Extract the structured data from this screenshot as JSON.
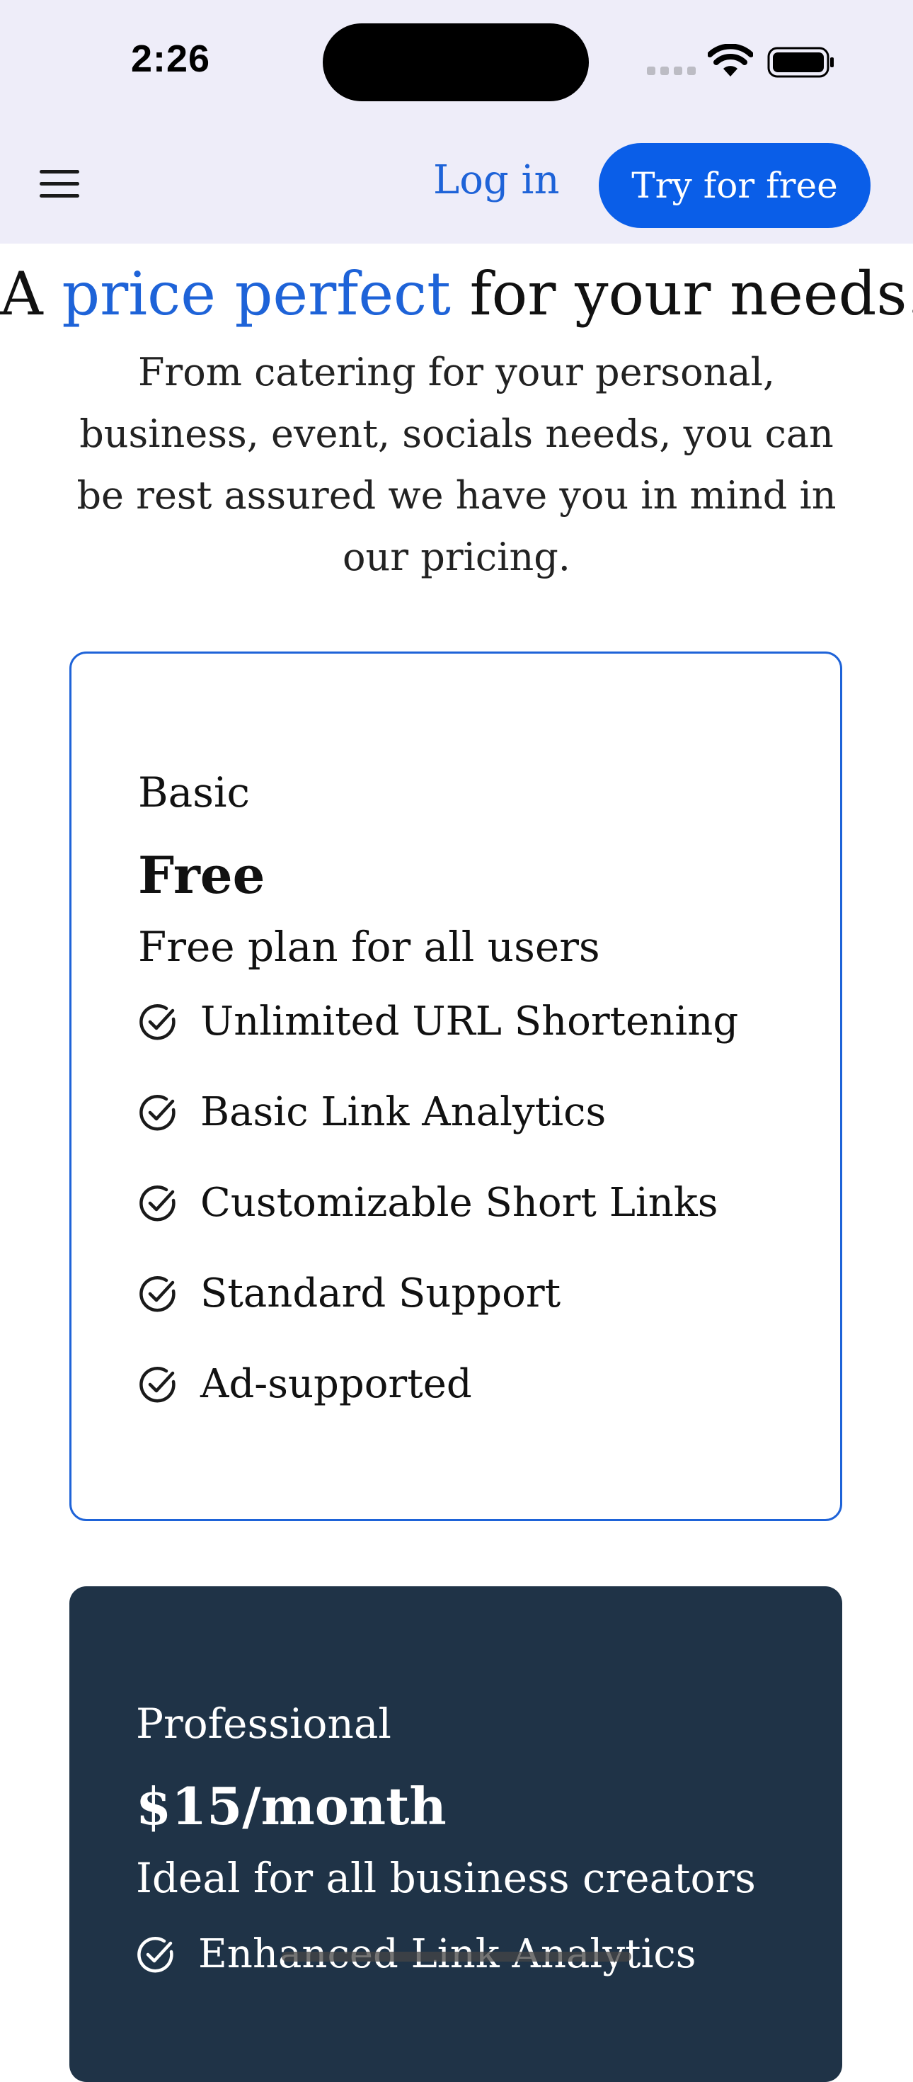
{
  "status_bar": {
    "time": "2:26"
  },
  "header": {
    "login_label": "Log in",
    "cta_label": "Try for free"
  },
  "hero": {
    "title_prefix": "A ",
    "title_accent": "price perfect",
    "title_suffix": " for your needs.",
    "subtitle": "From catering for your personal, business, event, socials needs, you can be rest assured we have you in mind in our pricing."
  },
  "plans": [
    {
      "name": "Basic",
      "price": "Free",
      "description": "Free plan for all users",
      "features": [
        "Unlimited URL Shortening",
        "Basic Link Analytics",
        "Customizable Short Links",
        "Standard Support",
        "Ad-supported"
      ]
    },
    {
      "name": "Professional",
      "price": "$15/month",
      "description": "Ideal for all business creators",
      "features": [
        "Enhanced Link Analytics"
      ]
    }
  ],
  "colors": {
    "accent": "#1e63d8",
    "cta_background": "#0a5ee8",
    "header_background": "#eeedf9",
    "pro_card_background": "#1f3347"
  },
  "icons": {
    "menu": "hamburger-menu-icon",
    "feature": "check-circle-icon",
    "wifi": "wifi-icon",
    "battery": "battery-icon"
  }
}
